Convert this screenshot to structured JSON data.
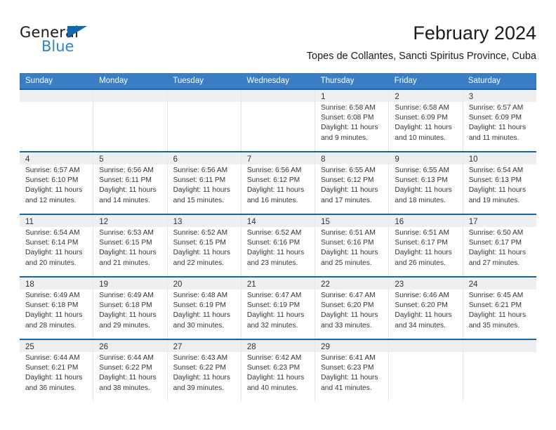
{
  "logo": {
    "word1": "General",
    "word2": "Blue",
    "triangle_color": "#1267ad",
    "blue_color": "#2a85d0"
  },
  "header": {
    "title": "February 2024",
    "subtitle": "Topes de Collantes, Sancti Spiritus Province, Cuba"
  },
  "theme": {
    "header_band": "#3b7dc4",
    "row_divider": "#1565a8",
    "day_band": "#efefef"
  },
  "weekdays": [
    "Sunday",
    "Monday",
    "Tuesday",
    "Wednesday",
    "Thursday",
    "Friday",
    "Saturday"
  ],
  "weeks": [
    [
      {
        "day": "",
        "sunrise": "",
        "sunset": "",
        "daylight1": "",
        "daylight2": ""
      },
      {
        "day": "",
        "sunrise": "",
        "sunset": "",
        "daylight1": "",
        "daylight2": ""
      },
      {
        "day": "",
        "sunrise": "",
        "sunset": "",
        "daylight1": "",
        "daylight2": ""
      },
      {
        "day": "",
        "sunrise": "",
        "sunset": "",
        "daylight1": "",
        "daylight2": ""
      },
      {
        "day": "1",
        "sunrise": "Sunrise: 6:58 AM",
        "sunset": "Sunset: 6:08 PM",
        "daylight1": "Daylight: 11 hours",
        "daylight2": "and 9 minutes."
      },
      {
        "day": "2",
        "sunrise": "Sunrise: 6:58 AM",
        "sunset": "Sunset: 6:09 PM",
        "daylight1": "Daylight: 11 hours",
        "daylight2": "and 10 minutes."
      },
      {
        "day": "3",
        "sunrise": "Sunrise: 6:57 AM",
        "sunset": "Sunset: 6:09 PM",
        "daylight1": "Daylight: 11 hours",
        "daylight2": "and 11 minutes."
      }
    ],
    [
      {
        "day": "4",
        "sunrise": "Sunrise: 6:57 AM",
        "sunset": "Sunset: 6:10 PM",
        "daylight1": "Daylight: 11 hours",
        "daylight2": "and 12 minutes."
      },
      {
        "day": "5",
        "sunrise": "Sunrise: 6:56 AM",
        "sunset": "Sunset: 6:11 PM",
        "daylight1": "Daylight: 11 hours",
        "daylight2": "and 14 minutes."
      },
      {
        "day": "6",
        "sunrise": "Sunrise: 6:56 AM",
        "sunset": "Sunset: 6:11 PM",
        "daylight1": "Daylight: 11 hours",
        "daylight2": "and 15 minutes."
      },
      {
        "day": "7",
        "sunrise": "Sunrise: 6:56 AM",
        "sunset": "Sunset: 6:12 PM",
        "daylight1": "Daylight: 11 hours",
        "daylight2": "and 16 minutes."
      },
      {
        "day": "8",
        "sunrise": "Sunrise: 6:55 AM",
        "sunset": "Sunset: 6:12 PM",
        "daylight1": "Daylight: 11 hours",
        "daylight2": "and 17 minutes."
      },
      {
        "day": "9",
        "sunrise": "Sunrise: 6:55 AM",
        "sunset": "Sunset: 6:13 PM",
        "daylight1": "Daylight: 11 hours",
        "daylight2": "and 18 minutes."
      },
      {
        "day": "10",
        "sunrise": "Sunrise: 6:54 AM",
        "sunset": "Sunset: 6:13 PM",
        "daylight1": "Daylight: 11 hours",
        "daylight2": "and 19 minutes."
      }
    ],
    [
      {
        "day": "11",
        "sunrise": "Sunrise: 6:54 AM",
        "sunset": "Sunset: 6:14 PM",
        "daylight1": "Daylight: 11 hours",
        "daylight2": "and 20 minutes."
      },
      {
        "day": "12",
        "sunrise": "Sunrise: 6:53 AM",
        "sunset": "Sunset: 6:15 PM",
        "daylight1": "Daylight: 11 hours",
        "daylight2": "and 21 minutes."
      },
      {
        "day": "13",
        "sunrise": "Sunrise: 6:52 AM",
        "sunset": "Sunset: 6:15 PM",
        "daylight1": "Daylight: 11 hours",
        "daylight2": "and 22 minutes."
      },
      {
        "day": "14",
        "sunrise": "Sunrise: 6:52 AM",
        "sunset": "Sunset: 6:16 PM",
        "daylight1": "Daylight: 11 hours",
        "daylight2": "and 23 minutes."
      },
      {
        "day": "15",
        "sunrise": "Sunrise: 6:51 AM",
        "sunset": "Sunset: 6:16 PM",
        "daylight1": "Daylight: 11 hours",
        "daylight2": "and 25 minutes."
      },
      {
        "day": "16",
        "sunrise": "Sunrise: 6:51 AM",
        "sunset": "Sunset: 6:17 PM",
        "daylight1": "Daylight: 11 hours",
        "daylight2": "and 26 minutes."
      },
      {
        "day": "17",
        "sunrise": "Sunrise: 6:50 AM",
        "sunset": "Sunset: 6:17 PM",
        "daylight1": "Daylight: 11 hours",
        "daylight2": "and 27 minutes."
      }
    ],
    [
      {
        "day": "18",
        "sunrise": "Sunrise: 6:49 AM",
        "sunset": "Sunset: 6:18 PM",
        "daylight1": "Daylight: 11 hours",
        "daylight2": "and 28 minutes."
      },
      {
        "day": "19",
        "sunrise": "Sunrise: 6:49 AM",
        "sunset": "Sunset: 6:18 PM",
        "daylight1": "Daylight: 11 hours",
        "daylight2": "and 29 minutes."
      },
      {
        "day": "20",
        "sunrise": "Sunrise: 6:48 AM",
        "sunset": "Sunset: 6:19 PM",
        "daylight1": "Daylight: 11 hours",
        "daylight2": "and 30 minutes."
      },
      {
        "day": "21",
        "sunrise": "Sunrise: 6:47 AM",
        "sunset": "Sunset: 6:19 PM",
        "daylight1": "Daylight: 11 hours",
        "daylight2": "and 32 minutes."
      },
      {
        "day": "22",
        "sunrise": "Sunrise: 6:47 AM",
        "sunset": "Sunset: 6:20 PM",
        "daylight1": "Daylight: 11 hours",
        "daylight2": "and 33 minutes."
      },
      {
        "day": "23",
        "sunrise": "Sunrise: 6:46 AM",
        "sunset": "Sunset: 6:20 PM",
        "daylight1": "Daylight: 11 hours",
        "daylight2": "and 34 minutes."
      },
      {
        "day": "24",
        "sunrise": "Sunrise: 6:45 AM",
        "sunset": "Sunset: 6:21 PM",
        "daylight1": "Daylight: 11 hours",
        "daylight2": "and 35 minutes."
      }
    ],
    [
      {
        "day": "25",
        "sunrise": "Sunrise: 6:44 AM",
        "sunset": "Sunset: 6:21 PM",
        "daylight1": "Daylight: 11 hours",
        "daylight2": "and 36 minutes."
      },
      {
        "day": "26",
        "sunrise": "Sunrise: 6:44 AM",
        "sunset": "Sunset: 6:22 PM",
        "daylight1": "Daylight: 11 hours",
        "daylight2": "and 38 minutes."
      },
      {
        "day": "27",
        "sunrise": "Sunrise: 6:43 AM",
        "sunset": "Sunset: 6:22 PM",
        "daylight1": "Daylight: 11 hours",
        "daylight2": "and 39 minutes."
      },
      {
        "day": "28",
        "sunrise": "Sunrise: 6:42 AM",
        "sunset": "Sunset: 6:23 PM",
        "daylight1": "Daylight: 11 hours",
        "daylight2": "and 40 minutes."
      },
      {
        "day": "29",
        "sunrise": "Sunrise: 6:41 AM",
        "sunset": "Sunset: 6:23 PM",
        "daylight1": "Daylight: 11 hours",
        "daylight2": "and 41 minutes."
      },
      {
        "day": "",
        "sunrise": "",
        "sunset": "",
        "daylight1": "",
        "daylight2": ""
      },
      {
        "day": "",
        "sunrise": "",
        "sunset": "",
        "daylight1": "",
        "daylight2": ""
      }
    ]
  ]
}
